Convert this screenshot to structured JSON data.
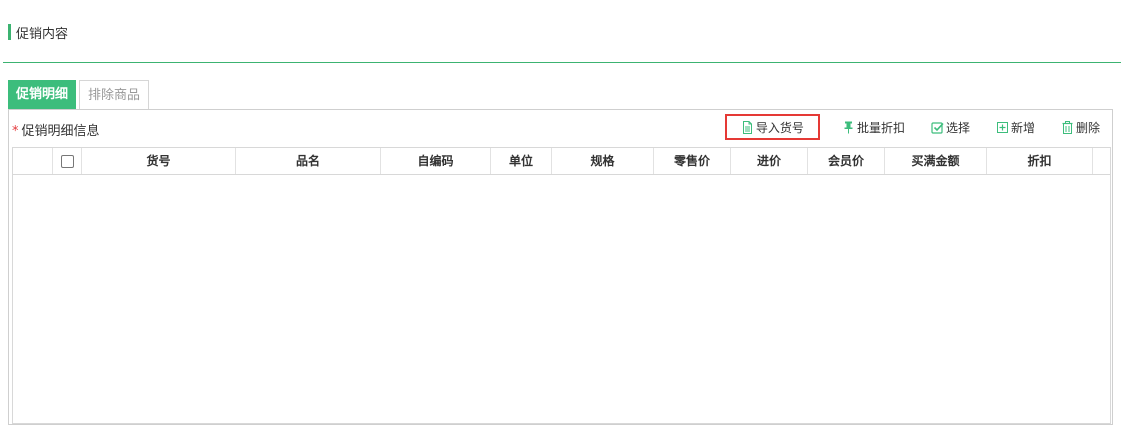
{
  "section": {
    "title": "促销内容"
  },
  "tabs": [
    {
      "label": "促销明细",
      "active": true
    },
    {
      "label": "排除商品",
      "active": false
    }
  ],
  "panel": {
    "required_mark": "*",
    "title": "促销明细信息"
  },
  "toolbar": {
    "import_label": "导入货号",
    "batch_discount_label": "批量折扣",
    "select_label": "选择",
    "add_label": "新增",
    "delete_label": "删除"
  },
  "grid": {
    "columns": [
      "货号",
      "品名",
      "自编码",
      "单位",
      "规格",
      "零售价",
      "进价",
      "会员价",
      "买满金额",
      "折扣"
    ],
    "rows": []
  },
  "colors": {
    "accent": "#3cbd7c",
    "highlight_border": "#e53935"
  }
}
